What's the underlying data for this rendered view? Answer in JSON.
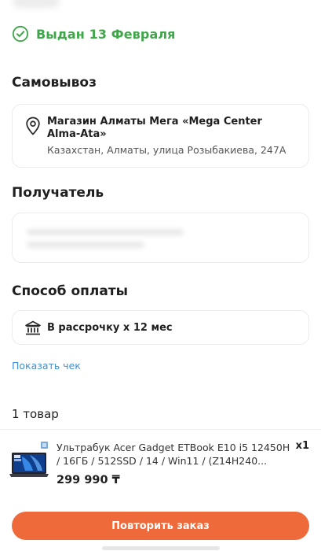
{
  "order_status": {
    "text": "Выдан 13 Февраля",
    "icon": "check-circle-icon",
    "color": "#3fa64a"
  },
  "pickup": {
    "title": "Самовывоз",
    "store_name": "Магазин Алматы Мега «Mega Center Alma-Ata»",
    "address": "Казахстан, Алматы, улица Розыбакиева, 247А",
    "icon": "location-pin-icon"
  },
  "recipient": {
    "title": "Получатель"
  },
  "payment": {
    "title": "Способ оплаты",
    "method": "В рассрочку х 12 мес",
    "icon": "bank-icon"
  },
  "receipt": {
    "link_label": "Показать чек",
    "color": "#3f8fd6"
  },
  "items": {
    "count_label": "1 товар",
    "list": [
      {
        "name": "Ультрабук Acer Gadget ETBook E10 i5 12450H / 16ГБ / 512SSD / 14 / Win11 / (Z14H240...",
        "quantity": "x1",
        "price": "299 990 ₸"
      }
    ]
  },
  "actions": {
    "repeat_order_label": "Повторить заказ",
    "accent_color": "#ef6a3a"
  }
}
